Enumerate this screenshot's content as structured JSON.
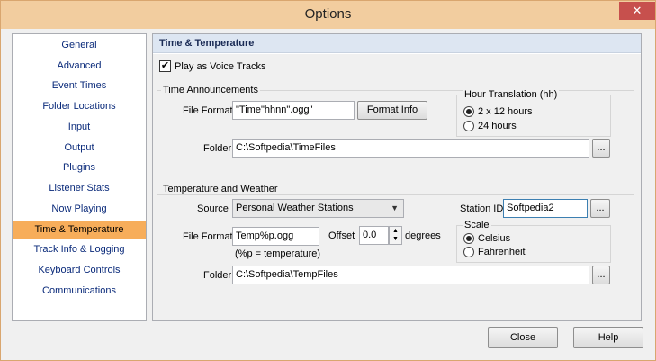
{
  "window": {
    "title": "Options",
    "close_glyph": "✕"
  },
  "sidebar": {
    "items": [
      {
        "label": "General"
      },
      {
        "label": "Advanced"
      },
      {
        "label": "Event Times"
      },
      {
        "label": "Folder Locations"
      },
      {
        "label": "Input"
      },
      {
        "label": "Output"
      },
      {
        "label": "Plugins"
      },
      {
        "label": "Listener Stats"
      },
      {
        "label": "Now Playing"
      },
      {
        "label": "Time & Temperature"
      },
      {
        "label": "Track Info & Logging"
      },
      {
        "label": "Keyboard Controls"
      },
      {
        "label": "Communications"
      }
    ],
    "active": "Time & Temperature"
  },
  "content": {
    "header": "Time & Temperature",
    "play_voice_tracks": {
      "label": "Play as Voice Tracks",
      "checked": true
    },
    "time_announcements": {
      "title": "Time Announcements",
      "file_format_label": "File Format",
      "file_format_value": "\"Time\"hhnn\".ogg\"",
      "format_info_button": "Format Info",
      "folder_label": "Folder",
      "folder_value": "C:\\Softpedia\\TimeFiles",
      "browse_label": "...",
      "hour_translation": {
        "title": "Hour Translation (hh)",
        "options": [
          "2 x 12 hours",
          "24 hours"
        ],
        "selected": "2 x 12 hours"
      }
    },
    "temperature_weather": {
      "title": "Temperature and Weather",
      "source_label": "Source",
      "source_value": "Personal Weather Stations",
      "station_id_label": "Station ID",
      "station_id_value": "Softpedia2",
      "browse_label": "...",
      "file_format_label": "File Format",
      "file_format_value": "Temp%p.ogg",
      "file_format_hint": "(%p = temperature)",
      "offset_label": "Offset",
      "offset_value": "0.0",
      "offset_unit": "degrees",
      "folder_label": "Folder",
      "folder_value": "C:\\Softpedia\\TempFiles",
      "scale": {
        "title": "Scale",
        "options": [
          "Celsius",
          "Fahrenheit"
        ],
        "selected": "Celsius"
      }
    }
  },
  "footer": {
    "close_label": "Close",
    "help_label": "Help"
  },
  "colors": {
    "titlebar": "#f2cd9f",
    "active_nav": "#f7ad5a",
    "nav_text": "#0a2a7a",
    "header_bg": "#dde6f2"
  }
}
